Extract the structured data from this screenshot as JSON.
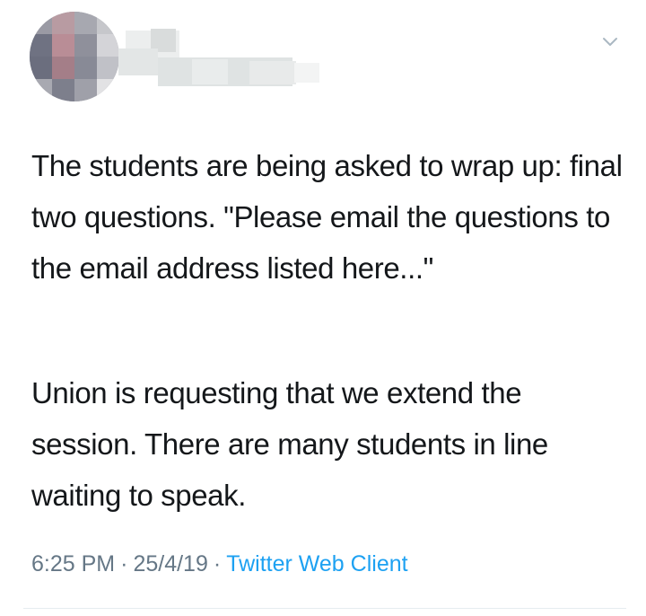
{
  "tweet": {
    "paragraphs": [
      "The students are being asked to wrap up: final two questions. \"Please email the questions to the email address listed here...\"",
      "Union is requesting that we extend the session. There are many students in line waiting to speak."
    ],
    "time": "6:25 PM",
    "date": "25/4/19",
    "source": "Twitter Web Client",
    "separator": "·"
  },
  "icons": {
    "more": "chevron-down-icon"
  },
  "colors": {
    "text": "#14171a",
    "meta": "#657786",
    "link": "#1da1f2",
    "divider": "#e6ecf0"
  }
}
